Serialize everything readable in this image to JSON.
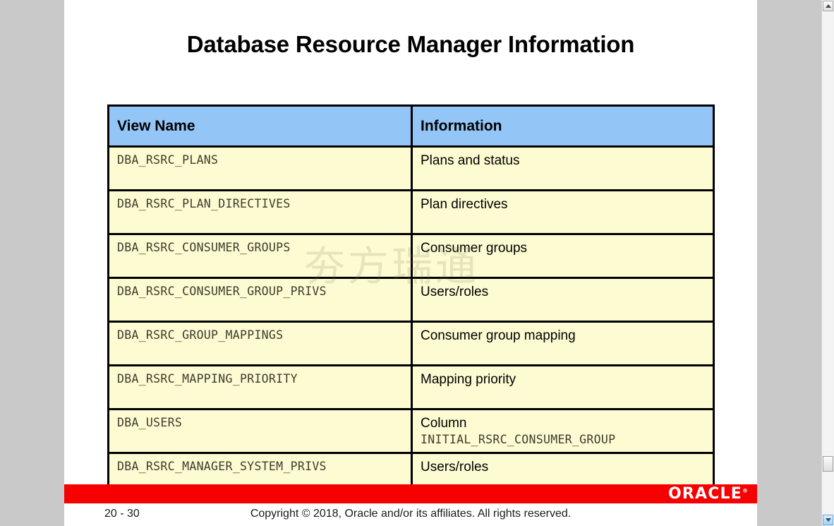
{
  "slide": {
    "title": "Database Resource Manager Information"
  },
  "watermark": {
    "text": "夯方瑞通"
  },
  "table": {
    "headers": [
      "View Name",
      "Information"
    ],
    "rows": [
      {
        "view": "DBA_RSRC_PLANS",
        "info": "Plans and status",
        "info2": ""
      },
      {
        "view": "DBA_RSRC_PLAN_DIRECTIVES",
        "info": "Plan directives",
        "info2": ""
      },
      {
        "view": "DBA_RSRC_CONSUMER_GROUPS",
        "info": "Consumer groups",
        "info2": ""
      },
      {
        "view": "DBA_RSRC_CONSUMER_GROUP_PRIVS",
        "info": "Users/roles",
        "info2": ""
      },
      {
        "view": "DBA_RSRC_GROUP_MAPPINGS",
        "info": "Consumer group mapping",
        "info2": ""
      },
      {
        "view": "DBA_RSRC_MAPPING_PRIORITY",
        "info": "Mapping priority",
        "info2": ""
      },
      {
        "view": "DBA_USERS",
        "info": "Column",
        "info2": "INITIAL_RSRC_CONSUMER_GROUP"
      },
      {
        "view": "DBA_RSRC_MANAGER_SYSTEM_PRIVS",
        "info": "Users/roles",
        "info2": ""
      }
    ]
  },
  "footer": {
    "logo": "ORACLE",
    "logo_mark": "®",
    "page_number": "20 - 30",
    "copyright": "Copyright © 2018, Oracle and/or its affiliates. All rights reserved."
  },
  "colors": {
    "header_blue": "#93c6f7",
    "cell_cream": "#fdfbd2",
    "oracle_red": "#f60000",
    "app_background": "#c9c9c9"
  }
}
